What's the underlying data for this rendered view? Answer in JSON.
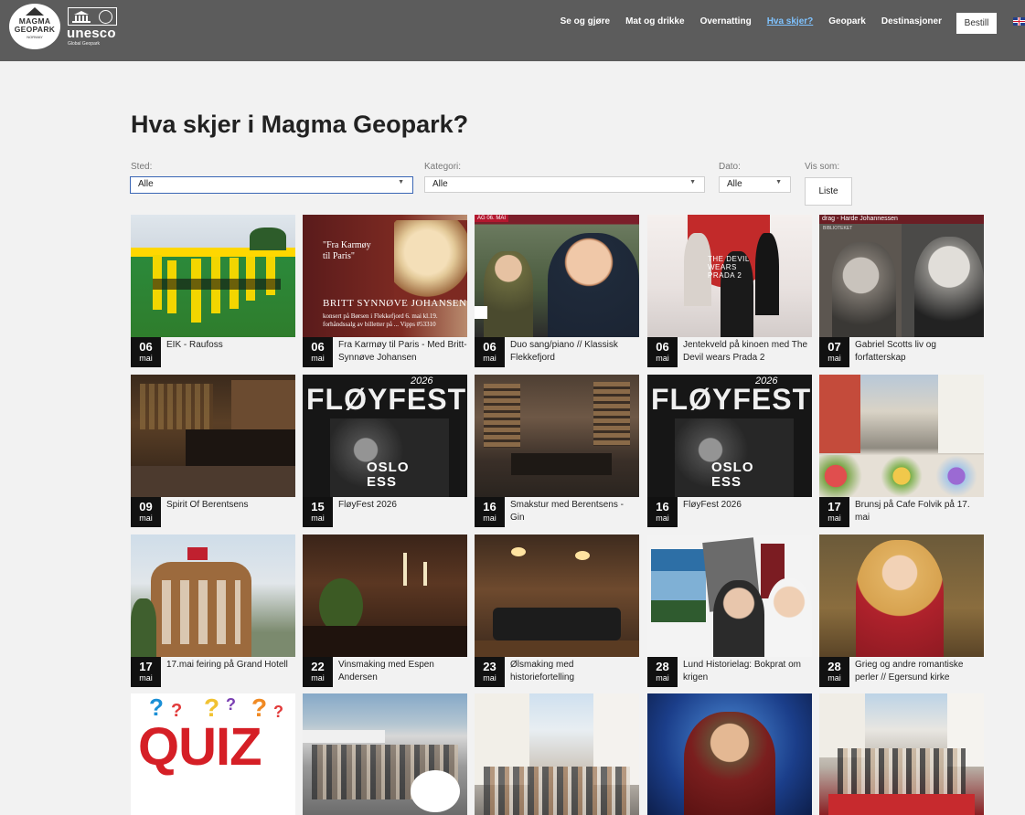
{
  "header": {
    "logo": {
      "line1": "MAGMA",
      "line2": "GEOPARK",
      "line3": "NORWAY"
    },
    "unesco": {
      "name": "unesco",
      "sub": "Global Geopark"
    },
    "nav": [
      {
        "label": "Se og gjøre",
        "active": false
      },
      {
        "label": "Mat og drikke",
        "active": false
      },
      {
        "label": "Overnatting",
        "active": false
      },
      {
        "label": "Hva skjer?",
        "active": true
      },
      {
        "label": "Geopark",
        "active": false
      },
      {
        "label": "Destinasjoner",
        "active": false
      }
    ],
    "cta_label": "Bestill",
    "language_icon": "uk-flag-icon"
  },
  "page": {
    "title": "Hva skjer i Magma Geopark?"
  },
  "filters": {
    "sted": {
      "label": "Sted:",
      "value": "Alle"
    },
    "kategori": {
      "label": "Kategori:",
      "value": "Alle"
    },
    "dato": {
      "label": "Dato:",
      "value": "Alle"
    },
    "vis_som": {
      "label": "Vis som:",
      "button": "Liste"
    }
  },
  "events": [
    {
      "day": "06",
      "month": "mai",
      "title": "EIK - Raufoss"
    },
    {
      "day": "06",
      "month": "mai",
      "title": "Fra Karmøy til Paris - Med Britt-Synnøve Johansen"
    },
    {
      "day": "06",
      "month": "mai",
      "title": "Duo sang/piano // Klassisk Flekkefjord"
    },
    {
      "day": "06",
      "month": "mai",
      "title": "Jentekveld på kinoen med The Devil wears Prada 2"
    },
    {
      "day": "07",
      "month": "mai",
      "title": "Gabriel Scotts liv og forfatterskap"
    },
    {
      "day": "09",
      "month": "mai",
      "title": "Spirit Of Berentsens"
    },
    {
      "day": "15",
      "month": "mai",
      "title": "FløyFest 2026"
    },
    {
      "day": "16",
      "month": "mai",
      "title": "Smakstur med Berentsens - Gin"
    },
    {
      "day": "16",
      "month": "mai",
      "title": "FløyFest 2026"
    },
    {
      "day": "17",
      "month": "mai",
      "title": "Brunsj på Cafe Folvik på 17. mai"
    },
    {
      "day": "17",
      "month": "mai",
      "title": "17.mai feiring på Grand Hotell"
    },
    {
      "day": "22",
      "month": "mai",
      "title": "Vinsmaking med Espen Andersen"
    },
    {
      "day": "23",
      "month": "mai",
      "title": "Ølsmaking med historiefortelling"
    },
    {
      "day": "28",
      "month": "mai",
      "title": "Lund Historielag: Bokprat om krigen"
    },
    {
      "day": "28",
      "month": "mai",
      "title": "Grieg og andre romantiske perler // Egersund kirke"
    }
  ],
  "image_text": {
    "karmoy_quote": "\"Fra Karmøy\ntil Paris\"",
    "karmoy_name": "BRITT SYNNØVE JOHANSEN",
    "karmoy_info": "konsert på Børsen i Flekkefjord 6. mai kl.19.\nforhåndssalg av billetter på ... Vipps #53310",
    "duo_banner": "AG 06. MAI",
    "gabriel_banner": "drag - Harde Johannessen",
    "gabriel_sub": "BIBLIOTEKET",
    "devil_text": "THE DEVIL WEARS PRADA 2",
    "floyfest_word": "FLØYFEST",
    "floyfest_year": "2026",
    "floyfest_line": "OSLO ESS",
    "quiz_word": "QUIZ"
  }
}
